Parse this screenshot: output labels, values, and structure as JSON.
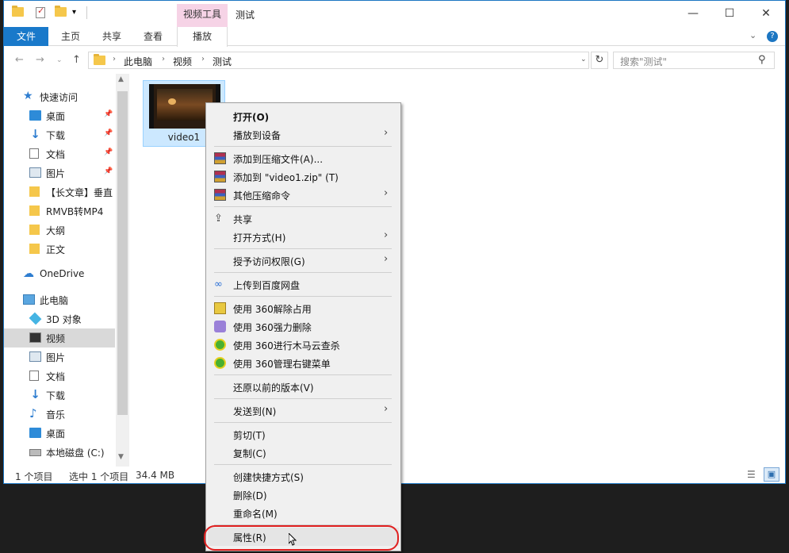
{
  "window": {
    "title": "测试",
    "tool_tab_header": "视频工具",
    "min_glyph": "—",
    "max_glyph": "☐",
    "close_glyph": "✕"
  },
  "ribbon": {
    "tabs": [
      "文件",
      "主页",
      "共享",
      "查看",
      "播放"
    ],
    "active_tab": "文件",
    "accent": "#1979ca",
    "tool_tab_color": "#f6d3e6"
  },
  "address": {
    "crumbs": [
      "此电脑",
      "视频",
      "测试"
    ],
    "search_placeholder": "搜索\"测试\""
  },
  "nav_pane": {
    "items": [
      {
        "label": "快速访问",
        "icon": "star-icon"
      },
      {
        "label": "桌面",
        "icon": "desktop-icon",
        "pinned": true
      },
      {
        "label": "下载",
        "icon": "download-icon",
        "pinned": true
      },
      {
        "label": "文档",
        "icon": "document-icon",
        "pinned": true
      },
      {
        "label": "图片",
        "icon": "pictures-icon",
        "pinned": true
      },
      {
        "label": "【长文章】垂直",
        "icon": "folder-icon"
      },
      {
        "label": "RMVB转MP4",
        "icon": "folder-icon"
      },
      {
        "label": "大纲",
        "icon": "folder-icon"
      },
      {
        "label": "正文",
        "icon": "folder-icon"
      },
      {
        "label": "OneDrive",
        "icon": "cloud-icon"
      },
      {
        "label": "此电脑",
        "icon": "computer-icon"
      },
      {
        "label": "3D 对象",
        "icon": "3d-objects-icon"
      },
      {
        "label": "视频",
        "icon": "videos-icon",
        "selected": true
      },
      {
        "label": "图片",
        "icon": "pictures-icon"
      },
      {
        "label": "文档",
        "icon": "document-icon"
      },
      {
        "label": "下载",
        "icon": "download-icon"
      },
      {
        "label": "音乐",
        "icon": "music-icon"
      },
      {
        "label": "桌面",
        "icon": "desktop-icon"
      },
      {
        "label": "本地磁盘 (C:)",
        "icon": "drive-icon"
      }
    ]
  },
  "files": [
    {
      "name": "video1",
      "selected": true
    }
  ],
  "status": {
    "item_count": "1 个项目",
    "selection": "选中 1 个项目",
    "size": "34.4 MB"
  },
  "context_menu": {
    "groups": [
      [
        {
          "label": "打开(O)",
          "bold": true
        },
        {
          "label": "播放到设备",
          "submenu": true
        }
      ],
      [
        {
          "label": "添加到压缩文件(A)...",
          "icon": "winrar-icon"
        },
        {
          "label": "添加到 \"video1.zip\" (T)",
          "icon": "winrar-icon"
        },
        {
          "label": "其他压缩命令",
          "icon": "winrar-icon",
          "submenu": true
        }
      ],
      [
        {
          "label": "共享",
          "icon": "share-icon"
        },
        {
          "label": "打开方式(H)",
          "submenu": true
        }
      ],
      [
        {
          "label": "授予访问权限(G)",
          "submenu": true
        }
      ],
      [
        {
          "label": "上传到百度网盘",
          "icon": "baidu-netdisk-icon"
        }
      ],
      [
        {
          "label": "使用 360解除占用",
          "icon": "360-unlock-icon"
        },
        {
          "label": "使用 360强力删除",
          "icon": "360-shred-icon"
        },
        {
          "label": "使用 360进行木马云查杀",
          "icon": "360-scan-icon"
        },
        {
          "label": "使用 360管理右键菜单",
          "icon": "360-scan-icon"
        }
      ],
      [
        {
          "label": "还原以前的版本(V)"
        }
      ],
      [
        {
          "label": "发送到(N)",
          "submenu": true
        }
      ],
      [
        {
          "label": "剪切(T)"
        },
        {
          "label": "复制(C)"
        }
      ],
      [
        {
          "label": "创建快捷方式(S)"
        },
        {
          "label": "删除(D)"
        },
        {
          "label": "重命名(M)"
        }
      ],
      [
        {
          "label": "属性(R)",
          "highlighted": true
        }
      ]
    ],
    "highlight_color": "#e02020"
  }
}
